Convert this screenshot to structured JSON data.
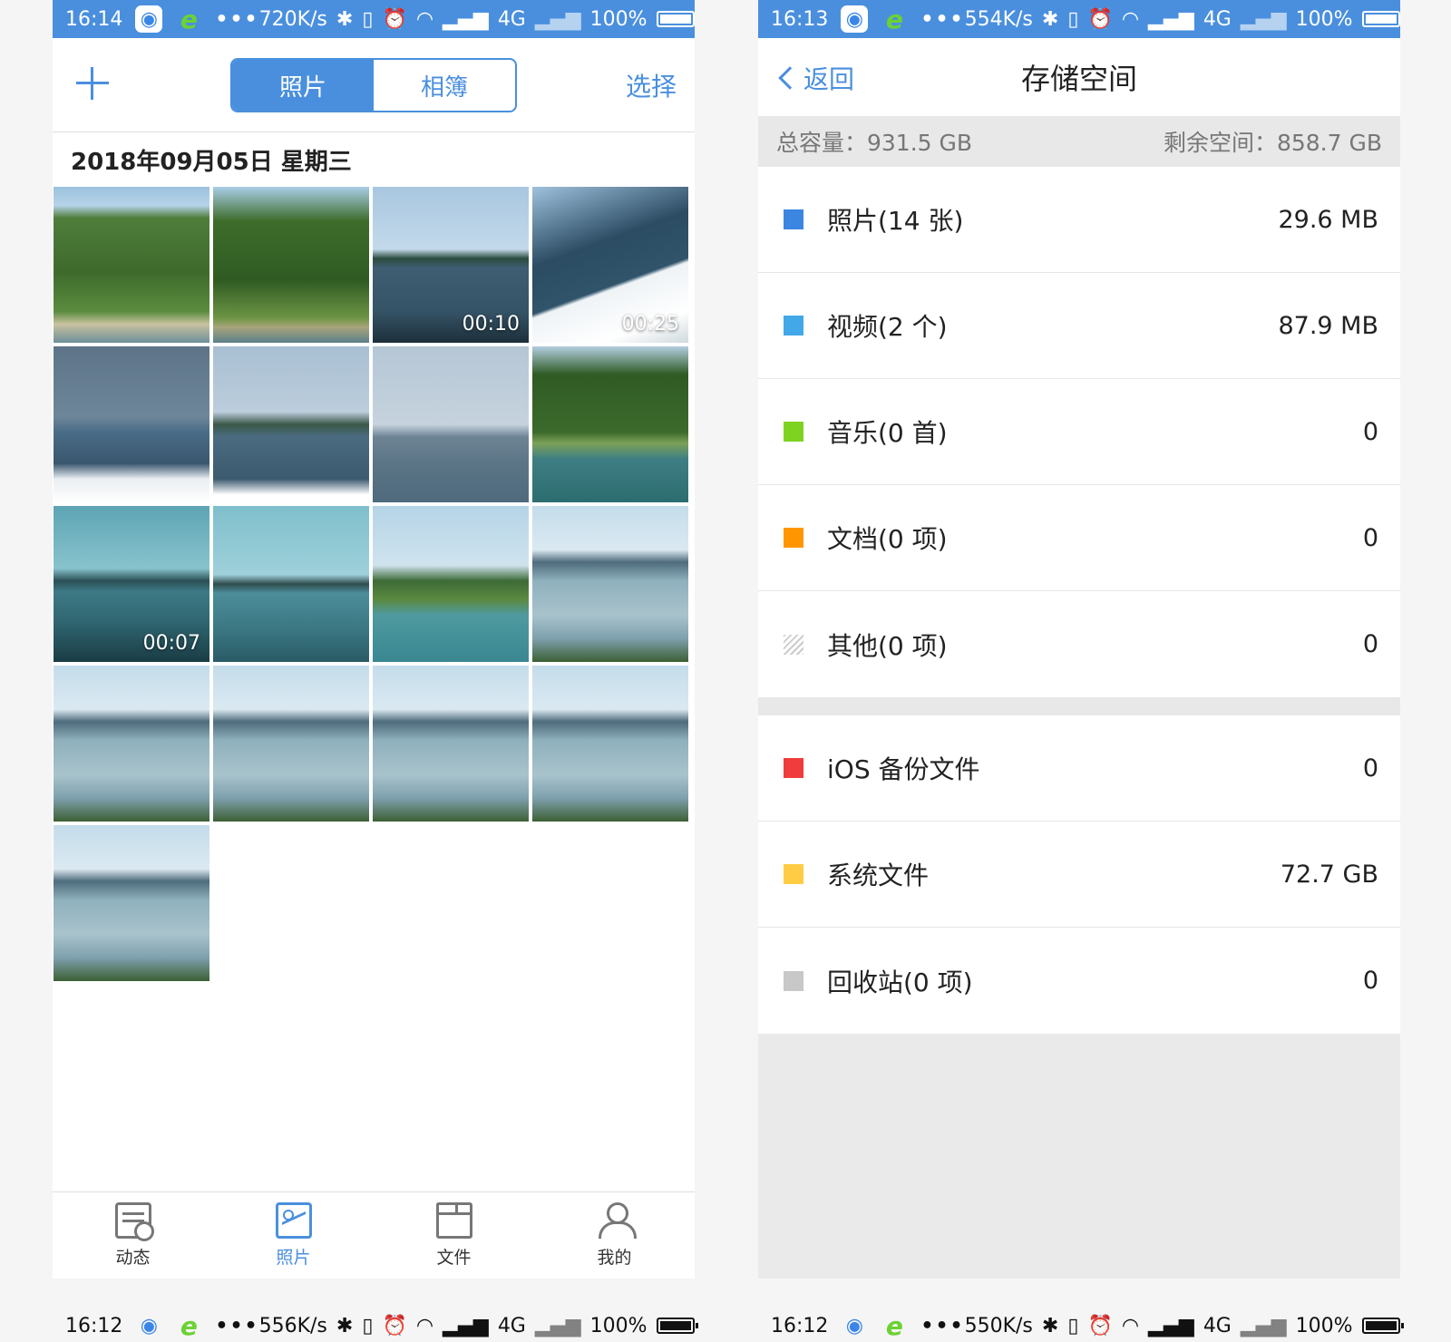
{
  "left_phone": {
    "status": {
      "time": "16:14",
      "speed": "720K/s",
      "network": "4G",
      "battery": "100%"
    },
    "topbar": {
      "segments": [
        {
          "label": "照片",
          "active": true
        },
        {
          "label": "相簿",
          "active": false
        }
      ],
      "select_label": "选择"
    },
    "date_header": "2018年09月05日 星期三",
    "thumbnails": [
      {
        "scene": "forest",
        "duration": ""
      },
      {
        "scene": "forest2",
        "duration": ""
      },
      {
        "scene": "lake",
        "duration": "00:10"
      },
      {
        "scene": "boat",
        "duration": "00:25"
      },
      {
        "scene": "life",
        "duration": ""
      },
      {
        "scene": "lake2",
        "duration": ""
      },
      {
        "scene": "haze",
        "duration": ""
      },
      {
        "scene": "forest3",
        "duration": ""
      },
      {
        "scene": "bridge",
        "duration": "00:07"
      },
      {
        "scene": "bridge2",
        "duration": ""
      },
      {
        "scene": "islands",
        "duration": ""
      },
      {
        "scene": "pier",
        "duration": ""
      },
      {
        "scene": "pier",
        "duration": ""
      },
      {
        "scene": "pier",
        "duration": ""
      },
      {
        "scene": "pier",
        "duration": ""
      },
      {
        "scene": "pier",
        "duration": ""
      },
      {
        "scene": "pier",
        "duration": ""
      }
    ],
    "tabs": [
      {
        "label": "动态",
        "icon": "feed-icon",
        "active": false
      },
      {
        "label": "照片",
        "icon": "photo-icon",
        "active": true
      },
      {
        "label": "文件",
        "icon": "folder-icon",
        "active": false
      },
      {
        "label": "我的",
        "icon": "profile-icon",
        "active": false
      }
    ],
    "bottom_status": {
      "time": "16:12",
      "speed": "556K/s",
      "network": "4G",
      "battery": "100%"
    }
  },
  "right_phone": {
    "status": {
      "time": "16:13",
      "speed": "554K/s",
      "network": "4G",
      "battery": "100%"
    },
    "nav": {
      "back_label": "返回",
      "title": "存储空间"
    },
    "capacity": {
      "total": "总容量：931.5 GB",
      "free": "剩余空间：858.7 GB"
    },
    "categories_main": [
      {
        "label": "照片(14 张)",
        "value": "29.6 MB",
        "color": "#3a86e0"
      },
      {
        "label": "视频(2 个)",
        "value": "87.9 MB",
        "color": "#42a8e8"
      },
      {
        "label": "音乐(0 首)",
        "value": "0",
        "color": "#7ed321"
      },
      {
        "label": "文档(0 项)",
        "value": "0",
        "color": "#ff9500"
      },
      {
        "label": "其他(0 项)",
        "value": "0",
        "color": "hatch"
      }
    ],
    "categories_system": [
      {
        "label": "iOS 备份文件",
        "value": "0",
        "color": "#f03c3c"
      },
      {
        "label": "系统文件",
        "value": "72.7 GB",
        "color": "#ffcc44"
      },
      {
        "label": "回收站(0 项)",
        "value": "0",
        "color": "#c8c8c8"
      }
    ],
    "bottom_status": {
      "time": "16:12",
      "speed": "550K/s",
      "network": "4G",
      "battery": "100%"
    }
  }
}
